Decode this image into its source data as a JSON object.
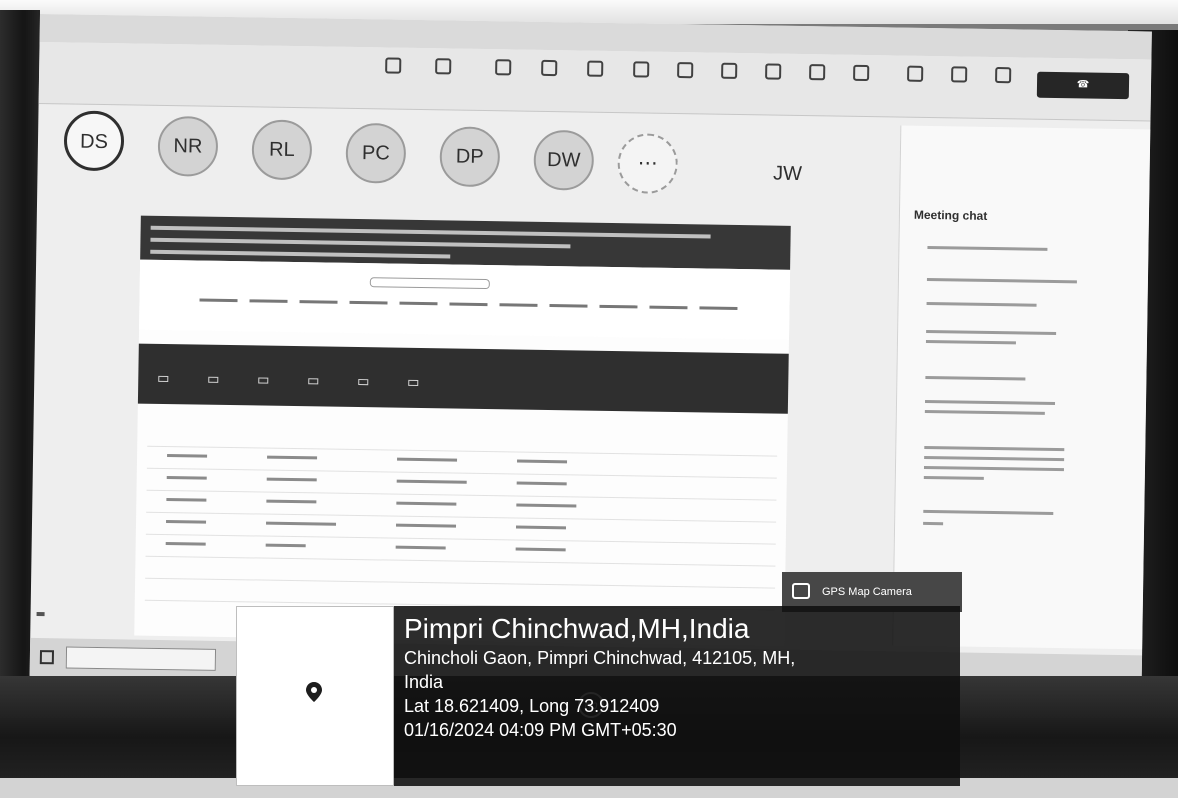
{
  "gps": {
    "city": "Pimpri Chinchwad,MH,India",
    "address_line1": "Chincholi Gaon, Pimpri Chinchwad, 412105, MH,",
    "address_line2": "India",
    "coords": "Lat 18.621409, Long 73.912409",
    "datetime": "01/16/2024 04:09 PM GMT+05:30",
    "badge": "GPS Map Camera"
  },
  "meeting": {
    "participants": [
      {
        "initials": "DS",
        "active": true
      },
      {
        "initials": "NR",
        "active": false
      },
      {
        "initials": "RL",
        "active": false
      },
      {
        "initials": "PC",
        "active": false
      },
      {
        "initials": "DP",
        "active": false
      },
      {
        "initials": "DW",
        "active": false
      },
      {
        "initials": "JW",
        "active": false
      }
    ],
    "chat_title": "Meeting chat"
  }
}
